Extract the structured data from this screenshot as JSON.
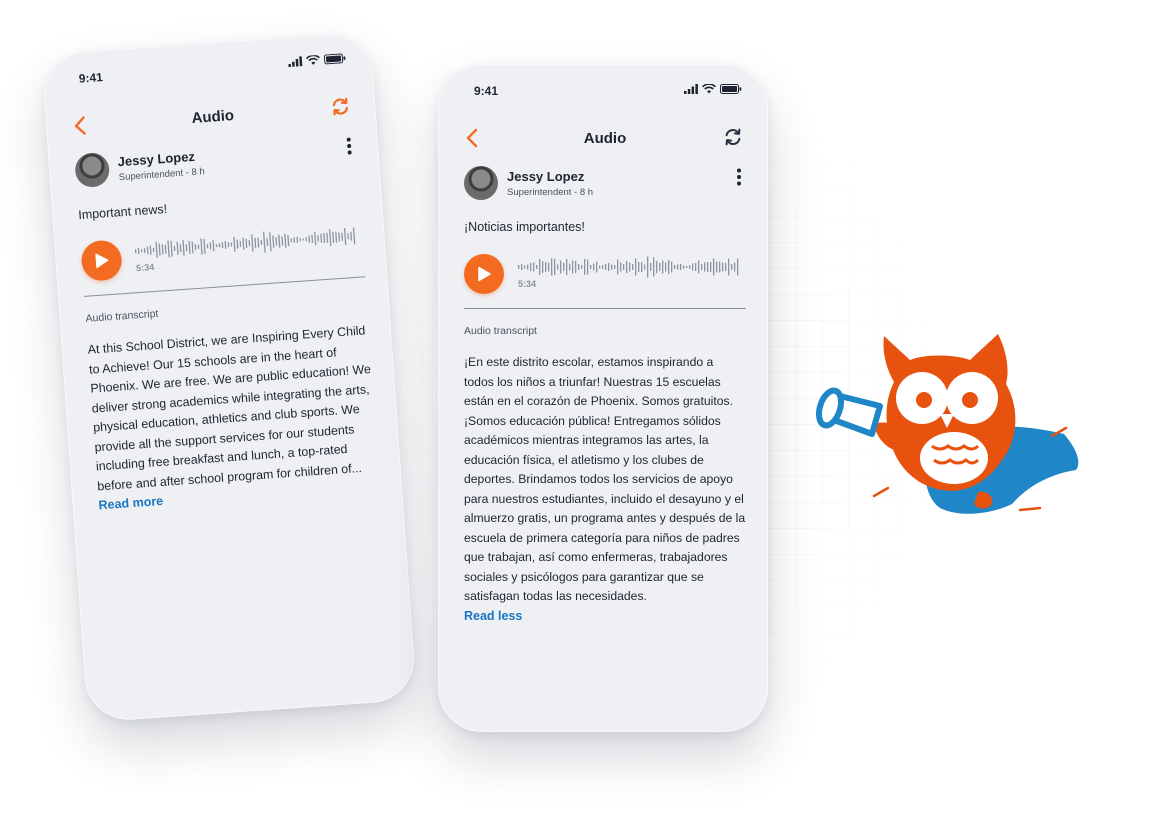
{
  "colors": {
    "accent": "#f26b21",
    "link": "#1a76c2",
    "mascot_orange": "#e8520f",
    "mascot_blue": "#1f86c8"
  },
  "phones": [
    {
      "status_time": "9:41",
      "nav_title": "Audio",
      "back_icon": "chevron-left-icon",
      "sync_icon": "sync-icon",
      "author_name": "Jessy Lopez",
      "author_role": "Superintendent - 8 h",
      "post_text": "Important news!",
      "duration": "5:34",
      "transcript_label": "Audio transcript",
      "transcript": "At this School District, we are Inspiring Every Child to Achieve! Our 15 schools are in the heart of Phoenix. We are free. We are public education! We deliver strong academics while integrating the arts, physical education, athletics and club sports. We provide all the support services for our students including free breakfast and lunch, a top-rated before and after school program for children of...",
      "read_link": "Read more"
    },
    {
      "status_time": "9:41",
      "nav_title": "Audio",
      "back_icon": "chevron-left-icon",
      "sync_icon": "sync-icon",
      "author_name": "Jessy Lopez",
      "author_role": "Superintendent - 8 h",
      "post_text": "¡Noticias importantes!",
      "duration": "5:34",
      "transcript_label": "Audio transcript",
      "transcript": "¡En este distrito escolar, estamos inspirando a todos los niños a triunfar! Nuestras 15 escuelas están en el corazón de Phoenix. Somos gratuitos. ¡Somos educación pública! Entregamos sólidos académicos mientras integramos las artes, la educación física, el atletismo y los clubes de deportes. Brindamos todos los servicios de apoyo para nuestros estudiantes, incluido el desayuno y el almuerzo gratis, un programa antes y después de la escuela de primera categoría para niños de padres que trabajan, así como enfermeras, trabajadores sociales y psicólogos para garantizar que se satisfagan todas las necesidades.",
      "read_link": "Read less"
    }
  ]
}
